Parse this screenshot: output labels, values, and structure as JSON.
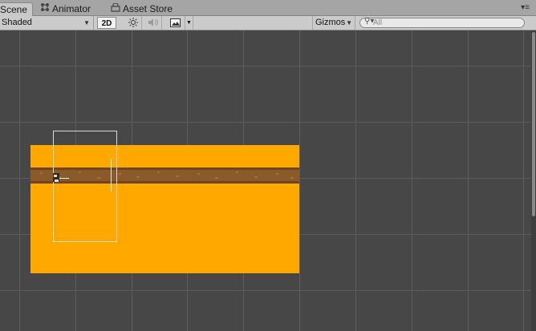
{
  "tabs": [
    {
      "label": "Scene",
      "icon": "scene-icon",
      "active": true
    },
    {
      "label": "Animator",
      "icon": "animator-icon",
      "active": false
    },
    {
      "label": "Asset Store",
      "icon": "asset-store-icon",
      "active": false
    }
  ],
  "toolbar": {
    "draw_mode": "Shaded",
    "mode_2d": "2D",
    "scene_lighting_icon": "sun-icon",
    "audio_icon": "audio-icon",
    "effects_icon": "image-effects-icon",
    "gizmos": "Gizmos",
    "search_placeholder": "All"
  },
  "scene": {
    "background_color": "#474747",
    "grid_color": "#5a5a5a",
    "ground_color": "#FFA800",
    "dirt_strip_color": "#8B5A2B",
    "camera_frame_color": "#d8d8d8"
  }
}
